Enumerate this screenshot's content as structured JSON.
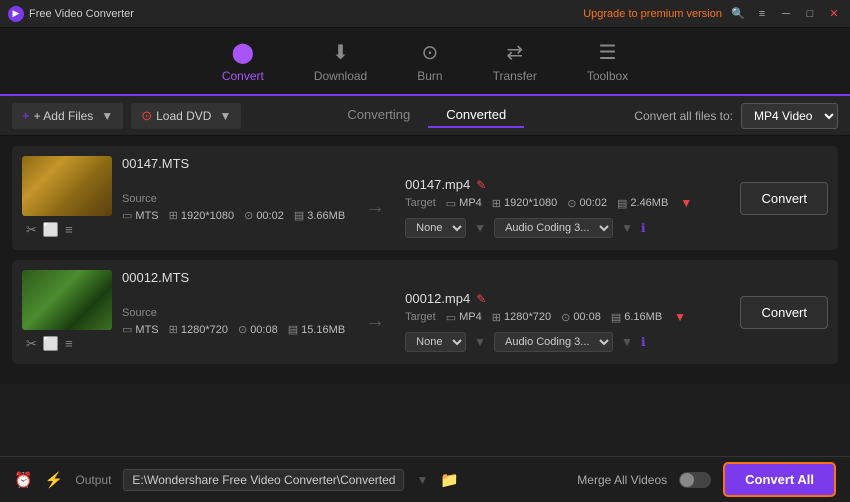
{
  "app": {
    "title": "Free Video Converter",
    "upgrade_label": "Upgrade to premium version"
  },
  "titlebar": {
    "window_controls": [
      "minimize",
      "maximize",
      "close"
    ]
  },
  "nav": {
    "items": [
      {
        "id": "convert",
        "label": "Convert",
        "active": true,
        "icon": "▶"
      },
      {
        "id": "download",
        "label": "Download",
        "active": false,
        "icon": "⬇"
      },
      {
        "id": "burn",
        "label": "Burn",
        "active": false,
        "icon": "⊙"
      },
      {
        "id": "transfer",
        "label": "Transfer",
        "active": false,
        "icon": "⇄"
      },
      {
        "id": "toolbox",
        "label": "Toolbox",
        "active": false,
        "icon": "☰"
      }
    ]
  },
  "toolbar": {
    "add_files_label": "+ Add Files",
    "load_dvd_label": "Load DVD",
    "converting_tab": "Converting",
    "converted_tab": "Converted",
    "convert_all_files_label": "Convert all files to:",
    "format_value": "MP4 Video"
  },
  "files": [
    {
      "id": "file1",
      "source_name": "00147.MTS",
      "target_name": "00147.mp4",
      "source": {
        "format": "MTS",
        "resolution": "1920*1080",
        "duration": "00:02",
        "size": "3.66MB"
      },
      "target": {
        "format": "MP4",
        "resolution": "1920*1080",
        "duration": "00:02",
        "size": "2.46MB"
      },
      "subtitle": "None",
      "audio": "Audio Coding 3...",
      "convert_btn": "Convert"
    },
    {
      "id": "file2",
      "source_name": "00012.MTS",
      "target_name": "00012.mp4",
      "source": {
        "format": "MTS",
        "resolution": "1280*720",
        "duration": "00:08",
        "size": "15.16MB"
      },
      "target": {
        "format": "MP4",
        "resolution": "1280*720",
        "duration": "00:08",
        "size": "6.16MB"
      },
      "subtitle": "None",
      "audio": "Audio Coding 3...",
      "convert_btn": "Convert"
    }
  ],
  "bottom": {
    "output_label": "Output",
    "output_path": "E:\\Wondershare Free Video Converter\\Converted",
    "merge_label": "Merge All Videos",
    "convert_all_btn": "Convert All"
  }
}
